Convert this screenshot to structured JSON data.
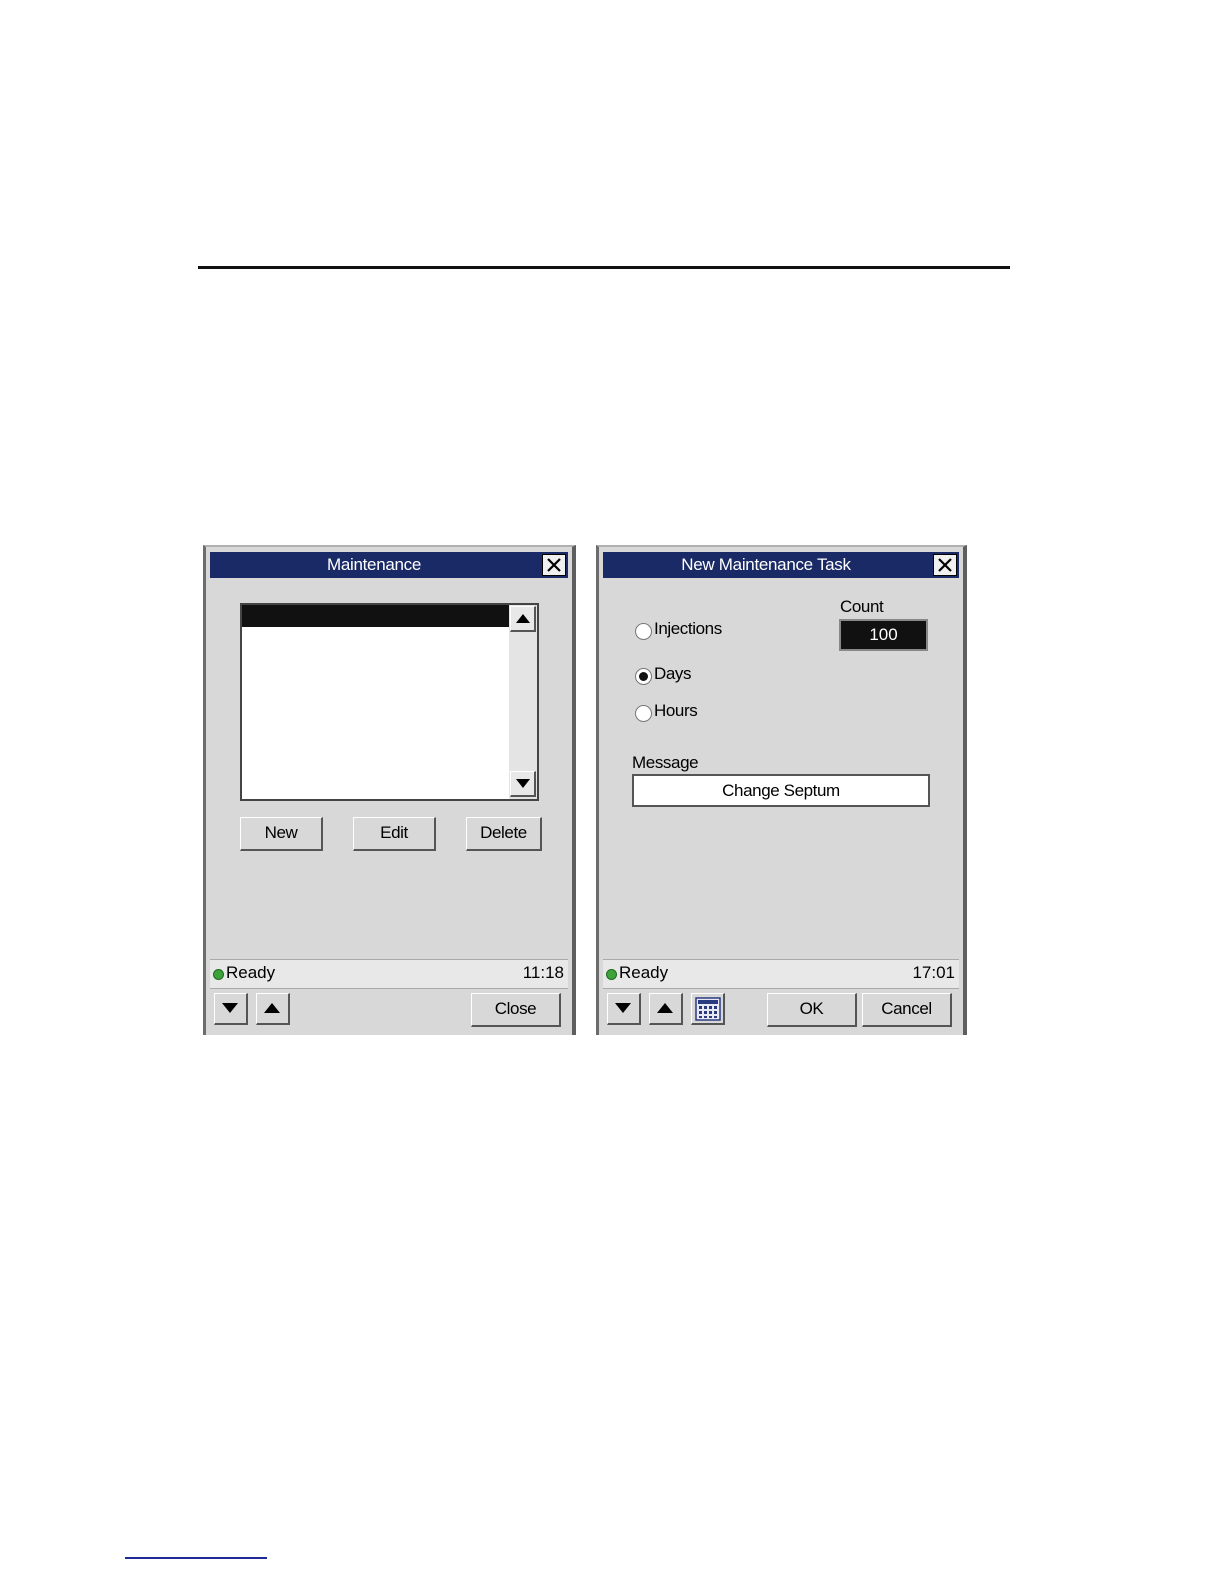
{
  "maintenance_window": {
    "title": "Maintenance",
    "list_items": [],
    "buttons": {
      "new": "New",
      "edit": "Edit",
      "delete": "Delete",
      "close": "Close"
    },
    "status": {
      "text": "Ready",
      "time": "11:18"
    }
  },
  "new_task_window": {
    "title": "New Maintenance Task",
    "radio_options": [
      {
        "label": "Injections",
        "selected": false
      },
      {
        "label": "Days",
        "selected": true
      },
      {
        "label": "Hours",
        "selected": false
      }
    ],
    "count_label": "Count",
    "count_value": "100",
    "message_label": "Message",
    "message_value": "Change Septum",
    "buttons": {
      "ok": "OK",
      "cancel": "Cancel"
    },
    "status": {
      "text": "Ready",
      "time": "17:01"
    }
  },
  "colors": {
    "titlebar": "#1a2a66",
    "window_bg": "#d8d8d8",
    "status_led": "#3fa23a"
  }
}
